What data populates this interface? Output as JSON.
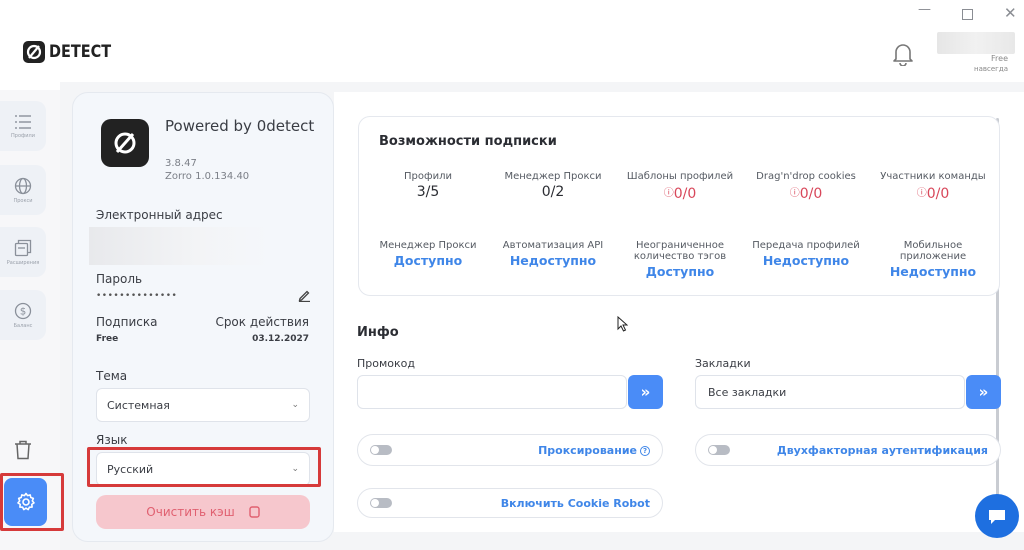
{
  "window": {
    "min_icon": "minimize-icon",
    "max_icon": "maximize-icon",
    "close_icon": "close-icon"
  },
  "header": {
    "logo_text": "DETECT",
    "plan": "Free",
    "plan_duration": "навсегда"
  },
  "nav": {
    "items": [
      {
        "label": "Профили",
        "icon": "list-icon"
      },
      {
        "label": "Прокси",
        "icon": "globe-icon"
      },
      {
        "label": "Расширения",
        "icon": "extensions-icon"
      },
      {
        "label": "Баланс",
        "icon": "dollar-icon"
      }
    ]
  },
  "profile": {
    "powered_by": "Powered by 0detect",
    "version": "3.8.47",
    "engine": "Zorro 1.0.134.40",
    "email_label": "Электронный адрес",
    "password_label": "Пароль",
    "password_value": "••••••••••••••",
    "subscription_label": "Подписка",
    "subscription_value": "Free",
    "expiry_label": "Срок действия",
    "expiry_value": "03.12.2027",
    "theme_label": "Тема",
    "theme_value": "Системная",
    "language_label": "Язык",
    "language_value": "Русский",
    "clear_cache": "Очистить кэш"
  },
  "subscription": {
    "title": "Возможности подписки",
    "row1": [
      {
        "title": "Профили",
        "value": "3/5",
        "style": "plain"
      },
      {
        "title": "Менеджер Прокси",
        "value": "0/2",
        "style": "plain"
      },
      {
        "title": "Шаблоны профилей",
        "value": "0/0",
        "style": "red"
      },
      {
        "title": "Drag'n'drop cookies",
        "value": "0/0",
        "style": "red"
      },
      {
        "title": "Участники команды",
        "value": "0/0",
        "style": "red"
      }
    ],
    "row2": [
      {
        "title": "Менеджер Прокси",
        "value": "Доступно"
      },
      {
        "title": "Автоматизация API",
        "value": "Недоступно"
      },
      {
        "title": "Неограниченное количество тэгов",
        "value": "Доступно"
      },
      {
        "title": "Передача профилей",
        "value": "Недоступно"
      },
      {
        "title": "Мобильное приложение",
        "value": "Недоступно"
      }
    ]
  },
  "info": {
    "title": "Инфо",
    "promo_label": "Промокод",
    "promo_value": "",
    "bookmarks_label": "Закладки",
    "bookmarks_value": "Все закладки",
    "go_symbol": "»",
    "proxying": "Проксирование",
    "two_factor": "Двухфакторная аутентификация",
    "cookie_robot": "Включить Cookie Robot"
  },
  "colors": {
    "accent": "#4a8cf7",
    "available": "#3f86e8",
    "limit": "#d8475a",
    "highlight": "#d63a3a"
  }
}
